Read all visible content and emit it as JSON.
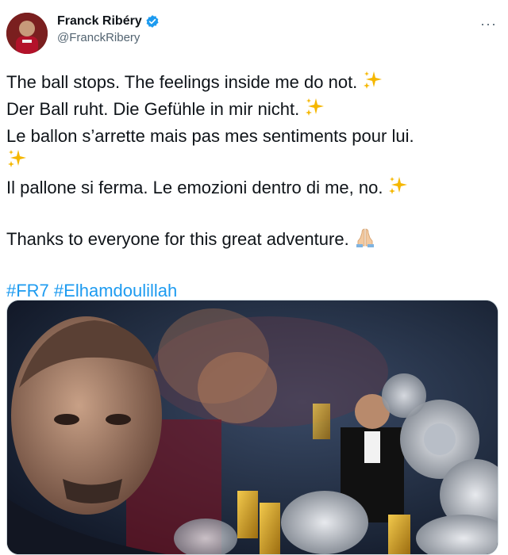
{
  "author": {
    "display_name": "Franck Ribéry",
    "handle": "@FranckRibery",
    "verified_icon": "verified-badge-icon"
  },
  "menu": {
    "more_label": "···"
  },
  "tweet": {
    "line1": "The ball stops. The feelings inside me do not.",
    "line2": "Der Ball ruht. Die Gefühle in mir nicht.",
    "line3": "Le ballon s’arrette mais pas mes sentiments pour lui.",
    "line4": "Il pallone si ferma. Le emozioni dentro di me, no.",
    "line5": "Thanks to everyone for this great adventure.",
    "hashtag1": "#FR7",
    "hashtag2": "#Elhamdoulillah"
  },
  "emoji": {
    "sparkles": "sparkles-icon",
    "praying_hands": "folded-hands-icon"
  },
  "colors": {
    "link": "#1d9bf0",
    "text": "#0f1419",
    "secondary": "#536471",
    "verified": "#1d9bf0"
  }
}
